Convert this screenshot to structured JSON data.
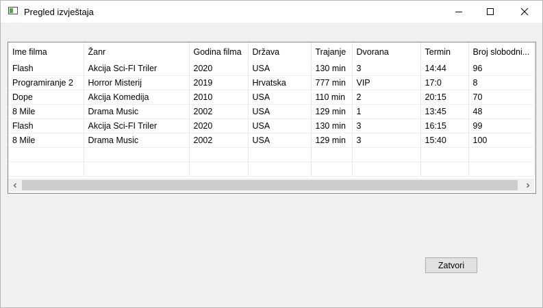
{
  "window": {
    "title": "Pregled izvještaja"
  },
  "table": {
    "columns": [
      "Ime filma",
      "Žanr",
      "Godina filma",
      "Država",
      "Trajanje",
      "Dvorana",
      "Termin",
      "Broj slobodni..."
    ],
    "rows": [
      [
        "Flash",
        "Akcija Sci-FI Triler",
        "2020",
        "USA",
        "130 min",
        "3",
        "14:44",
        "96"
      ],
      [
        "Programiranje 2",
        "Horror Misterij",
        "2019",
        "Hrvatska",
        "777 min",
        "VIP",
        "17:0",
        "8"
      ],
      [
        "Dope",
        "Akcija Komedija",
        "2010",
        "USA",
        "110 min",
        "2",
        "20:15",
        "70"
      ],
      [
        "8 Mile",
        "Drama Music",
        "2002",
        "USA",
        "129 min",
        "1",
        "13:45",
        "48"
      ],
      [
        "Flash",
        "Akcija Sci-FI Triler",
        "2020",
        "USA",
        "130 min",
        "3",
        "16:15",
        "99"
      ],
      [
        "8 Mile",
        "Drama Music",
        "2002",
        "USA",
        "129 min",
        "3",
        "15:40",
        "100"
      ]
    ],
    "empty_rows": 2
  },
  "buttons": {
    "close_label": "Zatvori"
  },
  "icons": {
    "app": "window-app-icon",
    "minimize": "minimize-icon",
    "maximize": "maximize-icon",
    "close": "close-icon",
    "scroll_left": "chevron-left-icon",
    "scroll_right": "chevron-right-icon"
  }
}
